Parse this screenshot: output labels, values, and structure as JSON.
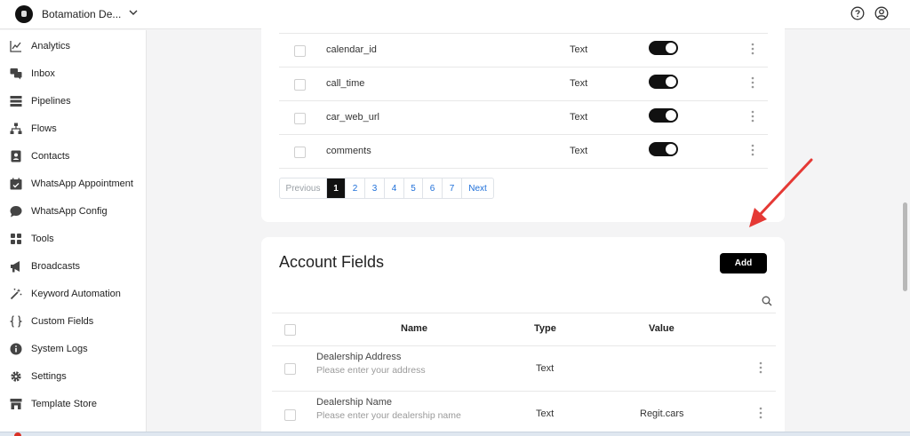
{
  "workspace": {
    "name": "Botamation De..."
  },
  "sidebar": {
    "items": [
      {
        "label": "Analytics",
        "icon": "chart-line-icon"
      },
      {
        "label": "Inbox",
        "icon": "chat-bubbles-icon"
      },
      {
        "label": "Pipelines",
        "icon": "pipelines-icon"
      },
      {
        "label": "Flows",
        "icon": "flow-tree-icon"
      },
      {
        "label": "Contacts",
        "icon": "contact-card-icon"
      },
      {
        "label": "WhatsApp Appointment",
        "icon": "calendar-icon"
      },
      {
        "label": "WhatsApp Config",
        "icon": "chat-bubble-icon"
      },
      {
        "label": "Tools",
        "icon": "grid-icon"
      },
      {
        "label": "Broadcasts",
        "icon": "megaphone-icon"
      },
      {
        "label": "Keyword Automation",
        "icon": "magic-wand-icon"
      },
      {
        "label": "Custom Fields",
        "icon": "braces-icon"
      },
      {
        "label": "System Logs",
        "icon": "info-icon"
      },
      {
        "label": "Settings",
        "icon": "gear-icon"
      },
      {
        "label": "Template Store",
        "icon": "store-icon"
      }
    ]
  },
  "contact_fields": {
    "rows": [
      {
        "name": "calendar_id",
        "type": "Text",
        "enabled": true
      },
      {
        "name": "call_time",
        "type": "Text",
        "enabled": true
      },
      {
        "name": "car_web_url",
        "type": "Text",
        "enabled": true
      },
      {
        "name": "comments",
        "type": "Text",
        "enabled": true
      }
    ],
    "pagination": {
      "previous": "Previous",
      "pages": [
        "1",
        "2",
        "3",
        "4",
        "5",
        "6",
        "7"
      ],
      "current": "1",
      "next": "Next"
    }
  },
  "account_fields": {
    "title": "Account Fields",
    "add_label": "Add",
    "columns": {
      "name": "Name",
      "type": "Type",
      "value": "Value"
    },
    "rows": [
      {
        "name": "Dealership Address",
        "placeholder": "Please enter your address",
        "type": "Text",
        "value": ""
      },
      {
        "name": "Dealership Name",
        "placeholder": "Please enter your dealership name",
        "type": "Text",
        "value": "Regit.cars"
      }
    ]
  },
  "colors": {
    "accent": "#000000",
    "link": "#1e6fd9",
    "annotation_arrow": "#e53935"
  }
}
